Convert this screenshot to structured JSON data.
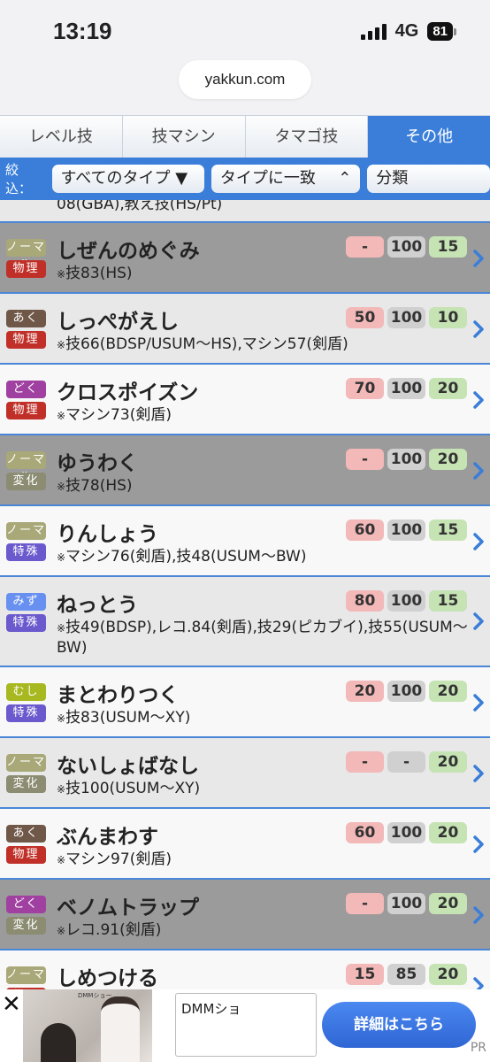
{
  "status": {
    "time": "13:19",
    "network": "4G",
    "battery": "81"
  },
  "browser": {
    "url": "yakkun.com"
  },
  "tabs": [
    {
      "label": "レベル技",
      "active": false
    },
    {
      "label": "技マシン",
      "active": false
    },
    {
      "label": "タマゴ技",
      "active": false
    },
    {
      "label": "その他",
      "active": true
    }
  ],
  "filter": {
    "label": "絞込：",
    "type_select": "すべてのタイプ ▼",
    "match_select": "タイプに一致",
    "class_select": "分類"
  },
  "list": {
    "top_cut_text": "08(GBA),教え技(HS/Pt)",
    "moves": [
      {
        "type": "ノーマル",
        "type_color": "#a8a878",
        "cls": "物理",
        "cls_color": "#c03028",
        "name": "しぜんのめぐみ",
        "source": "技83(HS)",
        "power": "-",
        "accuracy": "100",
        "pp": "15",
        "shade": "dark",
        "tall": false
      },
      {
        "type": "あく",
        "type_color": "#705848",
        "cls": "物理",
        "cls_color": "#c03028",
        "name": "しっぺがえし",
        "source": "技66(BDSP/USUM〜HS),マシン57(剣盾)",
        "power": "50",
        "accuracy": "100",
        "pp": "10",
        "shade": "mid",
        "tall": false
      },
      {
        "type": "どく",
        "type_color": "#a040a0",
        "cls": "物理",
        "cls_color": "#c03028",
        "name": "クロスポイズン",
        "source": "マシン73(剣盾)",
        "power": "70",
        "accuracy": "100",
        "pp": "20",
        "shade": "light",
        "tall": false
      },
      {
        "type": "ノーマル",
        "type_color": "#a8a878",
        "cls": "変化",
        "cls_color": "#8c8c72",
        "name": "ゆうわく",
        "source": "技78(HS)",
        "power": "-",
        "accuracy": "100",
        "pp": "20",
        "shade": "dark",
        "tall": false
      },
      {
        "type": "ノーマル",
        "type_color": "#a8a878",
        "cls": "特殊",
        "cls_color": "#6a5acd",
        "name": "りんしょう",
        "source": "マシン76(剣盾),技48(USUM〜BW)",
        "power": "60",
        "accuracy": "100",
        "pp": "15",
        "shade": "light",
        "tall": false
      },
      {
        "type": "みず",
        "type_color": "#6890f0",
        "cls": "特殊",
        "cls_color": "#6a5acd",
        "name": "ねっとう",
        "source": "技49(BDSP),レコ.84(剣盾),技29(ピカブイ),技55(USUM〜BW)",
        "power": "80",
        "accuracy": "100",
        "pp": "15",
        "shade": "mid",
        "tall": true
      },
      {
        "type": "むし",
        "type_color": "#a8b820",
        "cls": "特殊",
        "cls_color": "#6a5acd",
        "name": "まとわりつく",
        "source": "技83(USUM〜XY)",
        "power": "20",
        "accuracy": "100",
        "pp": "20",
        "shade": "light",
        "tall": false
      },
      {
        "type": "ノーマル",
        "type_color": "#a8a878",
        "cls": "変化",
        "cls_color": "#8c8c72",
        "name": "ないしょばなし",
        "source": "技100(USUM〜XY)",
        "power": "-",
        "accuracy": "-",
        "pp": "20",
        "shade": "mid",
        "tall": false
      },
      {
        "type": "あく",
        "type_color": "#705848",
        "cls": "物理",
        "cls_color": "#c03028",
        "name": "ぶんまわす",
        "source": "マシン97(剣盾)",
        "power": "60",
        "accuracy": "100",
        "pp": "20",
        "shade": "light",
        "tall": false
      },
      {
        "type": "どく",
        "type_color": "#a040a0",
        "cls": "変化",
        "cls_color": "#8c8c72",
        "name": "ベノムトラップ",
        "source": "レコ.91(剣盾)",
        "power": "-",
        "accuracy": "100",
        "pp": "20",
        "shade": "dark",
        "tall": false
      },
      {
        "type": "ノーマル",
        "type_color": "#a8a878",
        "cls": "物理",
        "cls_color": "#c03028",
        "name": "しめつける",
        "source": "",
        "power": "15",
        "accuracy": "85",
        "pp": "20",
        "shade": "light",
        "tall": false
      }
    ]
  },
  "ad": {
    "close": "✕",
    "thumb_brand": "DMMショー",
    "text": "DMMショ",
    "cta": "詳細はこちら",
    "pr": "PR"
  },
  "icons": {
    "chevron": "chevron-right-icon"
  }
}
